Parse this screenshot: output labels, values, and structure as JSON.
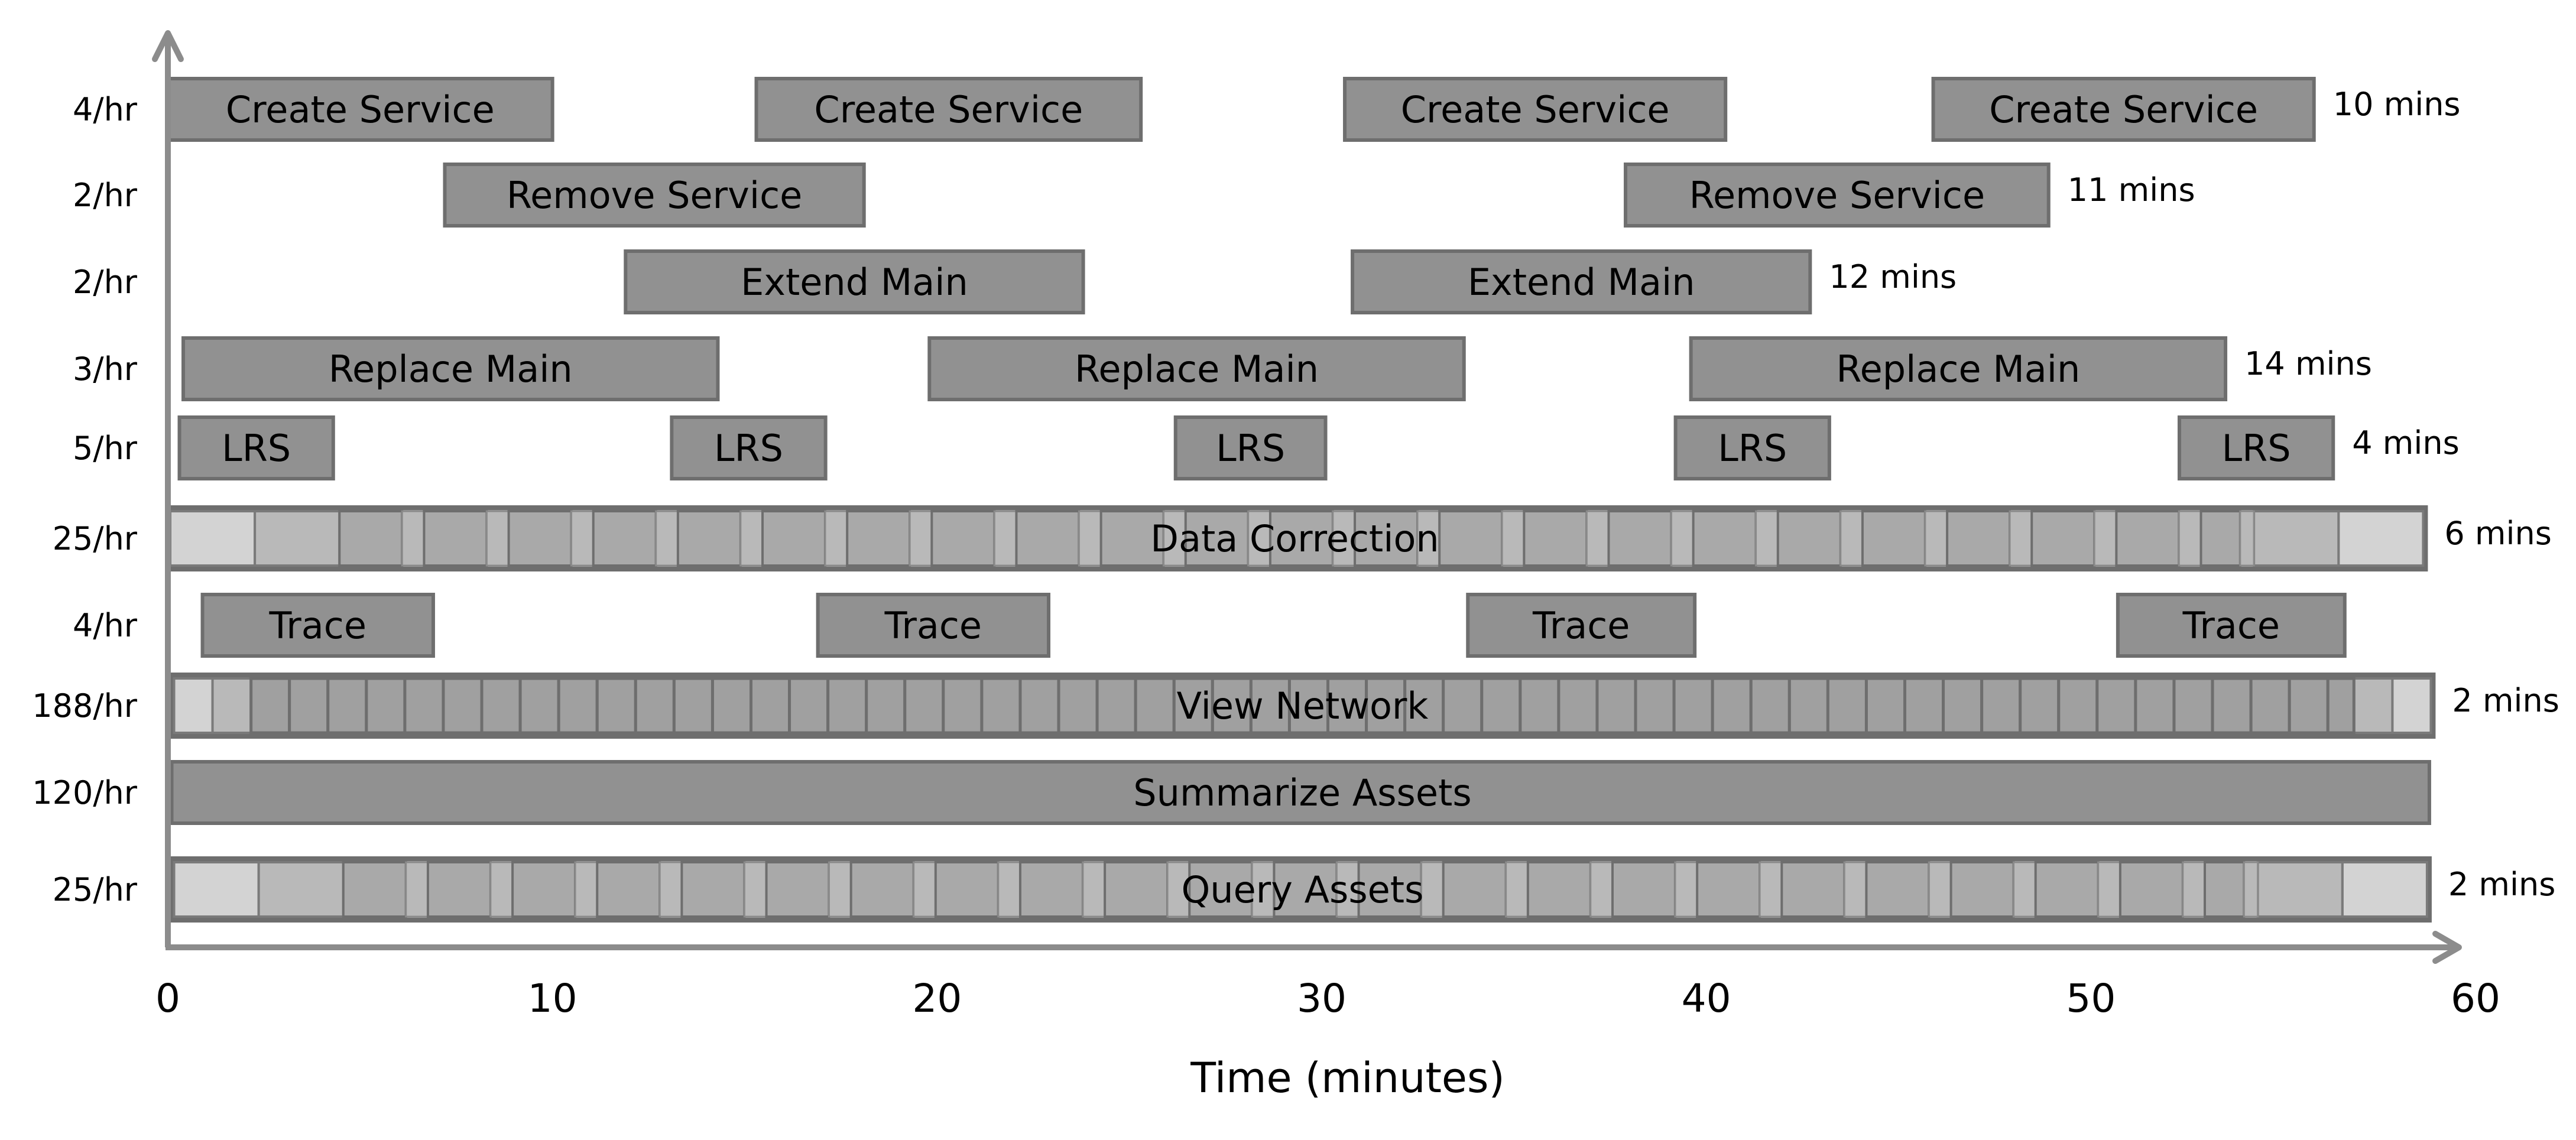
{
  "chart_data": {
    "type": "gantt",
    "title": "",
    "xlabel": "Time (minutes)",
    "ylabel": "",
    "xlim": [
      0,
      60
    ],
    "xticks": [
      0,
      10,
      20,
      30,
      40,
      50,
      60
    ],
    "xtick_labels": [
      "0",
      "10",
      "20",
      "30",
      "40",
      "50",
      "60"
    ],
    "grid": false,
    "legend": null,
    "colors": {
      "bar_fill": "#919191",
      "bar_stroke": "#6e6e6e",
      "axis": "#8c8c8c",
      "seg_light": "#d3d3d3",
      "seg_mid": "#b9b9b9",
      "seg_dark": "#a9a9a9",
      "seg_darker": "#a0a0a0"
    },
    "rows": [
      {
        "name": "Create Service",
        "rate": "4/hr",
        "duration": "10 mins",
        "style": "solid",
        "bars": [
          [
            0,
            10
          ],
          [
            15.3,
            25.3
          ],
          [
            30.6,
            40.5
          ],
          [
            45.9,
            55.8
          ]
        ]
      },
      {
        "name": "Remove Service",
        "rate": "2/hr",
        "duration": "11 mins",
        "style": "solid",
        "bars": [
          [
            7.2,
            18.1
          ],
          [
            37.9,
            48.9
          ]
        ]
      },
      {
        "name": "Extend Main",
        "rate": "2/hr",
        "duration": "12 mins",
        "style": "solid",
        "bars": [
          [
            11.9,
            23.8
          ],
          [
            30.8,
            42.7
          ]
        ]
      },
      {
        "name": "Replace Main",
        "rate": "3/hr",
        "duration": "14 mins",
        "style": "solid",
        "bars": [
          [
            0.4,
            14.3
          ],
          [
            19.8,
            33.7
          ],
          [
            39.6,
            53.5
          ]
        ]
      },
      {
        "name": "LRS",
        "rate": "5/hr",
        "duration": "4 mins",
        "style": "solid",
        "bars": [
          [
            0.3,
            4.3
          ],
          [
            13.1,
            17.1
          ],
          [
            26.2,
            30.1
          ],
          [
            39.2,
            43.2
          ],
          [
            52.3,
            56.3
          ]
        ]
      },
      {
        "name": "Data Correction",
        "rate": "25/hr",
        "duration": "6 mins",
        "style": "overlap",
        "bars": [
          [
            0,
            58.7
          ]
        ],
        "label_at": 29.3,
        "period": 2.2,
        "ramp_width": 2.2
      },
      {
        "name": "Trace",
        "rate": "4/hr",
        "duration": "",
        "style": "solid",
        "bars": [
          [
            0.9,
            6.9
          ],
          [
            16.9,
            22.9
          ],
          [
            33.8,
            39.7
          ],
          [
            50.7,
            56.6
          ]
        ]
      },
      {
        "name": "View Network",
        "rate": "188/hr",
        "duration": "2 mins",
        "style": "dense",
        "bars": [
          [
            0.1,
            58.9
          ]
        ],
        "label_at": 29.5,
        "period": 1.0,
        "ramp_width": 1.0
      },
      {
        "name": "Summarize Assets",
        "rate": "120/hr",
        "duration": "",
        "style": "solid",
        "bars": [
          [
            0.1,
            58.8
          ]
        ],
        "label_at": 29.5
      },
      {
        "name": "Query Assets",
        "rate": "25/hr",
        "duration": "2 mins",
        "style": "overlap",
        "bars": [
          [
            0.1,
            58.8
          ]
        ],
        "label_at": 29.5,
        "period": 2.2,
        "ramp_width": 2.2
      }
    ]
  }
}
